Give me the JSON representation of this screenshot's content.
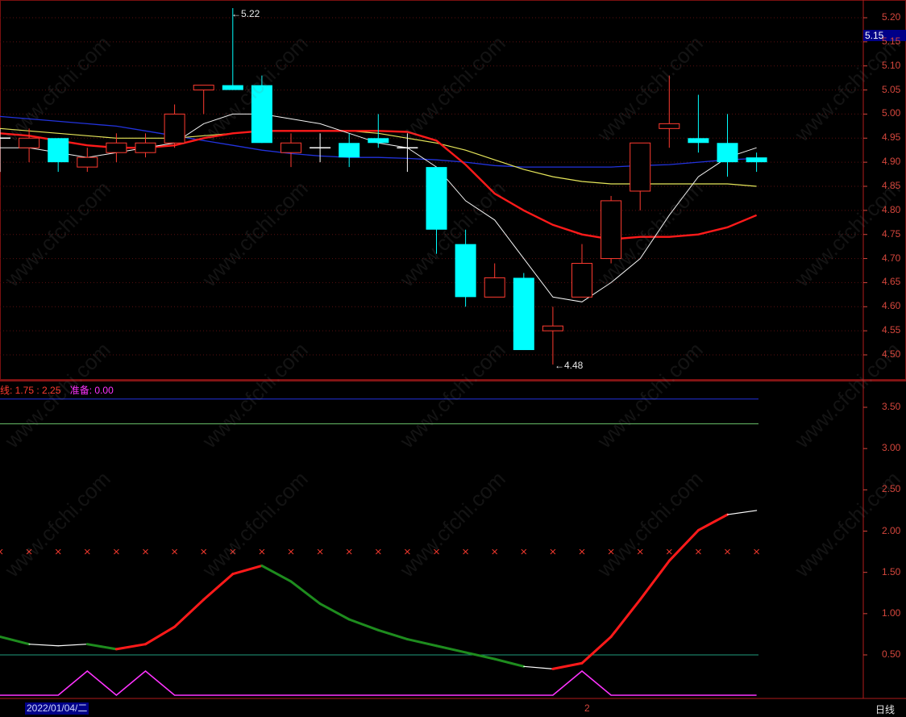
{
  "colors": {
    "background": "#000000",
    "up": "#ff3b30",
    "down": "#00ffff",
    "grid": "#5a1010",
    "axis_text": "#d4463c",
    "ma5": "#f5f5f5",
    "ma10": "#e6e65a",
    "ma20": "#ff1a1a",
    "ma60": "#2233dd",
    "line_up": "#ff1a1a",
    "line_down": "#1e8c1e",
    "line_flat": "#ffffff",
    "signal": "#ff33ff",
    "level_blue": "#2233dd",
    "level_green": "#66bb66",
    "level_teal": "#1f9c7c",
    "marker": "#ff3b30",
    "price_box": "#000088"
  },
  "watermark": "www.cfchi.com",
  "price_panel": {
    "current_price": "5.15",
    "max_label": "5.22",
    "min_label": "4.48",
    "max_arrow": "←",
    "min_arrow": "←"
  },
  "indicator_panel": {
    "legend_label": "线: 1.75 : 2.25",
    "legend_ready": "准备: 0.00"
  },
  "bottom_bar": {
    "date_label": "2022/01/04/二",
    "mid_label": "2",
    "period": "日线"
  },
  "chart_data": [
    {
      "type": "candlestick",
      "ylim": [
        4.45,
        5.25
      ],
      "yticks": [
        "5.20",
        "5.15",
        "5.10",
        "5.05",
        "5.00",
        "4.95",
        "4.90",
        "4.85",
        "4.80",
        "4.75",
        "4.70",
        "4.65",
        "4.60",
        "4.55",
        "4.50"
      ],
      "candles": [
        {
          "o": 4.95,
          "h": 4.97,
          "l": 4.88,
          "c": 4.95
        },
        {
          "o": 4.93,
          "h": 4.97,
          "l": 4.9,
          "c": 4.95
        },
        {
          "o": 4.95,
          "h": 4.95,
          "l": 4.88,
          "c": 4.9
        },
        {
          "o": 4.89,
          "h": 4.93,
          "l": 4.88,
          "c": 4.91
        },
        {
          "o": 4.92,
          "h": 4.96,
          "l": 4.9,
          "c": 4.94
        },
        {
          "o": 4.92,
          "h": 4.96,
          "l": 4.91,
          "c": 4.94
        },
        {
          "o": 4.94,
          "h": 5.02,
          "l": 4.93,
          "c": 5.0
        },
        {
          "o": 5.05,
          "h": 5.06,
          "l": 5.0,
          "c": 5.06
        },
        {
          "o": 5.06,
          "h": 5.22,
          "l": 5.05,
          "c": 5.05
        },
        {
          "o": 5.06,
          "h": 5.08,
          "l": 4.94,
          "c": 4.94
        },
        {
          "o": 4.92,
          "h": 4.96,
          "l": 4.89,
          "c": 4.94
        },
        {
          "o": 4.93,
          "h": 4.96,
          "l": 4.9,
          "c": 4.93
        },
        {
          "o": 4.94,
          "h": 4.96,
          "l": 4.89,
          "c": 4.91
        },
        {
          "o": 4.95,
          "h": 5.0,
          "l": 4.93,
          "c": 4.94
        },
        {
          "o": 4.93,
          "h": 4.96,
          "l": 4.88,
          "c": 4.93
        },
        {
          "o": 4.89,
          "h": 4.89,
          "l": 4.71,
          "c": 4.76
        },
        {
          "o": 4.73,
          "h": 4.76,
          "l": 4.6,
          "c": 4.62
        },
        {
          "o": 4.62,
          "h": 4.69,
          "l": 4.62,
          "c": 4.66
        },
        {
          "o": 4.66,
          "h": 4.67,
          "l": 4.51,
          "c": 4.51
        },
        {
          "o": 4.55,
          "h": 4.6,
          "l": 4.48,
          "c": 4.56
        },
        {
          "o": 4.62,
          "h": 4.73,
          "l": 4.62,
          "c": 4.69
        },
        {
          "o": 4.7,
          "h": 4.83,
          "l": 4.69,
          "c": 4.82
        },
        {
          "o": 4.84,
          "h": 4.94,
          "l": 4.8,
          "c": 4.94
        },
        {
          "o": 4.97,
          "h": 5.08,
          "l": 4.93,
          "c": 4.98
        },
        {
          "o": 4.95,
          "h": 5.04,
          "l": 4.92,
          "c": 4.94
        },
        {
          "o": 4.94,
          "h": 5.0,
          "l": 4.87,
          "c": 4.9
        },
        {
          "o": 4.91,
          "h": 4.92,
          "l": 4.88,
          "c": 4.9
        }
      ],
      "series": [
        {
          "id": "ma5",
          "values": [
            4.93,
            4.93,
            4.92,
            4.91,
            4.92,
            4.93,
            4.94,
            4.98,
            5.0,
            5.0,
            4.99,
            4.98,
            4.96,
            4.94,
            4.93,
            4.89,
            4.82,
            4.78,
            4.7,
            4.62,
            4.61,
            4.65,
            4.7,
            4.79,
            4.87,
            4.91,
            4.93
          ]
        },
        {
          "id": "ma10",
          "values": [
            4.97,
            4.965,
            4.96,
            4.955,
            4.95,
            4.95,
            4.95,
            4.955,
            4.96,
            4.965,
            4.965,
            4.965,
            4.965,
            4.96,
            4.95,
            4.94,
            4.925,
            4.905,
            4.885,
            4.87,
            4.86,
            4.855,
            4.855,
            4.855,
            4.855,
            4.855,
            4.85
          ]
        },
        {
          "id": "ma20",
          "values": [
            4.96,
            4.955,
            4.945,
            4.935,
            4.93,
            4.93,
            4.935,
            4.95,
            4.96,
            4.965,
            4.965,
            4.965,
            4.965,
            4.965,
            4.963,
            4.945,
            4.895,
            4.835,
            4.8,
            4.77,
            4.75,
            4.74,
            4.745,
            4.745,
            4.75,
            4.765,
            4.79
          ]
        },
        {
          "id": "ma60",
          "values": [
            4.995,
            4.99,
            4.985,
            4.98,
            4.975,
            4.965,
            4.955,
            4.945,
            4.935,
            4.925,
            4.918,
            4.913,
            4.91,
            4.91,
            4.908,
            4.905,
            4.9,
            4.893,
            4.89,
            4.89,
            4.89,
            4.89,
            4.893,
            4.895,
            4.9,
            4.905,
            4.908
          ]
        }
      ]
    },
    {
      "type": "line",
      "ylim": [
        0.0,
        3.8
      ],
      "yticks": [
        "3.50",
        "3.00",
        "2.50",
        "2.00",
        "1.50",
        "1.00",
        "0.50"
      ],
      "levels": [
        {
          "value": 3.6,
          "color_key": "level_blue"
        },
        {
          "value": 3.3,
          "color_key": "level_green"
        },
        {
          "value": 0.5,
          "color_key": "level_teal"
        }
      ],
      "marker_level": 1.75,
      "main": [
        0.72,
        0.63,
        0.61,
        0.63,
        0.57,
        0.63,
        0.84,
        1.17,
        1.48,
        1.58,
        1.39,
        1.12,
        0.93,
        0.8,
        0.69,
        0.61,
        0.53,
        0.45,
        0.36,
        0.33,
        0.4,
        0.72,
        1.17,
        1.64,
        2.01,
        2.2,
        2.25
      ],
      "signal": [
        0.0,
        0.0,
        0.0,
        0.3,
        0.0,
        0.3,
        0.0,
        0.0,
        0.0,
        0.0,
        0.0,
        0.0,
        0.0,
        0.0,
        0.0,
        0.0,
        0.0,
        0.0,
        0.0,
        0.0,
        0.3,
        0.0,
        0.0,
        0.0,
        0.0,
        0.0,
        0.0
      ]
    }
  ]
}
